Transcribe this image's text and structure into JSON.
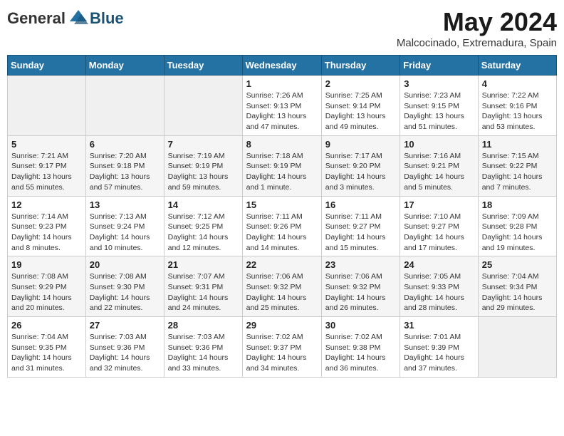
{
  "logo": {
    "text_general": "General",
    "text_blue": "Blue"
  },
  "header": {
    "month_year": "May 2024",
    "location": "Malcocinado, Extremadura, Spain"
  },
  "weekdays": [
    "Sunday",
    "Monday",
    "Tuesday",
    "Wednesday",
    "Thursday",
    "Friday",
    "Saturday"
  ],
  "weeks": [
    [
      {
        "day": "",
        "info": ""
      },
      {
        "day": "",
        "info": ""
      },
      {
        "day": "",
        "info": ""
      },
      {
        "day": "1",
        "info": "Sunrise: 7:26 AM\nSunset: 9:13 PM\nDaylight: 13 hours\nand 47 minutes."
      },
      {
        "day": "2",
        "info": "Sunrise: 7:25 AM\nSunset: 9:14 PM\nDaylight: 13 hours\nand 49 minutes."
      },
      {
        "day": "3",
        "info": "Sunrise: 7:23 AM\nSunset: 9:15 PM\nDaylight: 13 hours\nand 51 minutes."
      },
      {
        "day": "4",
        "info": "Sunrise: 7:22 AM\nSunset: 9:16 PM\nDaylight: 13 hours\nand 53 minutes."
      }
    ],
    [
      {
        "day": "5",
        "info": "Sunrise: 7:21 AM\nSunset: 9:17 PM\nDaylight: 13 hours\nand 55 minutes."
      },
      {
        "day": "6",
        "info": "Sunrise: 7:20 AM\nSunset: 9:18 PM\nDaylight: 13 hours\nand 57 minutes."
      },
      {
        "day": "7",
        "info": "Sunrise: 7:19 AM\nSunset: 9:19 PM\nDaylight: 13 hours\nand 59 minutes."
      },
      {
        "day": "8",
        "info": "Sunrise: 7:18 AM\nSunset: 9:19 PM\nDaylight: 14 hours\nand 1 minute."
      },
      {
        "day": "9",
        "info": "Sunrise: 7:17 AM\nSunset: 9:20 PM\nDaylight: 14 hours\nand 3 minutes."
      },
      {
        "day": "10",
        "info": "Sunrise: 7:16 AM\nSunset: 9:21 PM\nDaylight: 14 hours\nand 5 minutes."
      },
      {
        "day": "11",
        "info": "Sunrise: 7:15 AM\nSunset: 9:22 PM\nDaylight: 14 hours\nand 7 minutes."
      }
    ],
    [
      {
        "day": "12",
        "info": "Sunrise: 7:14 AM\nSunset: 9:23 PM\nDaylight: 14 hours\nand 8 minutes."
      },
      {
        "day": "13",
        "info": "Sunrise: 7:13 AM\nSunset: 9:24 PM\nDaylight: 14 hours\nand 10 minutes."
      },
      {
        "day": "14",
        "info": "Sunrise: 7:12 AM\nSunset: 9:25 PM\nDaylight: 14 hours\nand 12 minutes."
      },
      {
        "day": "15",
        "info": "Sunrise: 7:11 AM\nSunset: 9:26 PM\nDaylight: 14 hours\nand 14 minutes."
      },
      {
        "day": "16",
        "info": "Sunrise: 7:11 AM\nSunset: 9:27 PM\nDaylight: 14 hours\nand 15 minutes."
      },
      {
        "day": "17",
        "info": "Sunrise: 7:10 AM\nSunset: 9:27 PM\nDaylight: 14 hours\nand 17 minutes."
      },
      {
        "day": "18",
        "info": "Sunrise: 7:09 AM\nSunset: 9:28 PM\nDaylight: 14 hours\nand 19 minutes."
      }
    ],
    [
      {
        "day": "19",
        "info": "Sunrise: 7:08 AM\nSunset: 9:29 PM\nDaylight: 14 hours\nand 20 minutes."
      },
      {
        "day": "20",
        "info": "Sunrise: 7:08 AM\nSunset: 9:30 PM\nDaylight: 14 hours\nand 22 minutes."
      },
      {
        "day": "21",
        "info": "Sunrise: 7:07 AM\nSunset: 9:31 PM\nDaylight: 14 hours\nand 24 minutes."
      },
      {
        "day": "22",
        "info": "Sunrise: 7:06 AM\nSunset: 9:32 PM\nDaylight: 14 hours\nand 25 minutes."
      },
      {
        "day": "23",
        "info": "Sunrise: 7:06 AM\nSunset: 9:32 PM\nDaylight: 14 hours\nand 26 minutes."
      },
      {
        "day": "24",
        "info": "Sunrise: 7:05 AM\nSunset: 9:33 PM\nDaylight: 14 hours\nand 28 minutes."
      },
      {
        "day": "25",
        "info": "Sunrise: 7:04 AM\nSunset: 9:34 PM\nDaylight: 14 hours\nand 29 minutes."
      }
    ],
    [
      {
        "day": "26",
        "info": "Sunrise: 7:04 AM\nSunset: 9:35 PM\nDaylight: 14 hours\nand 31 minutes."
      },
      {
        "day": "27",
        "info": "Sunrise: 7:03 AM\nSunset: 9:36 PM\nDaylight: 14 hours\nand 32 minutes."
      },
      {
        "day": "28",
        "info": "Sunrise: 7:03 AM\nSunset: 9:36 PM\nDaylight: 14 hours\nand 33 minutes."
      },
      {
        "day": "29",
        "info": "Sunrise: 7:02 AM\nSunset: 9:37 PM\nDaylight: 14 hours\nand 34 minutes."
      },
      {
        "day": "30",
        "info": "Sunrise: 7:02 AM\nSunset: 9:38 PM\nDaylight: 14 hours\nand 36 minutes."
      },
      {
        "day": "31",
        "info": "Sunrise: 7:01 AM\nSunset: 9:39 PM\nDaylight: 14 hours\nand 37 minutes."
      },
      {
        "day": "",
        "info": ""
      }
    ]
  ]
}
